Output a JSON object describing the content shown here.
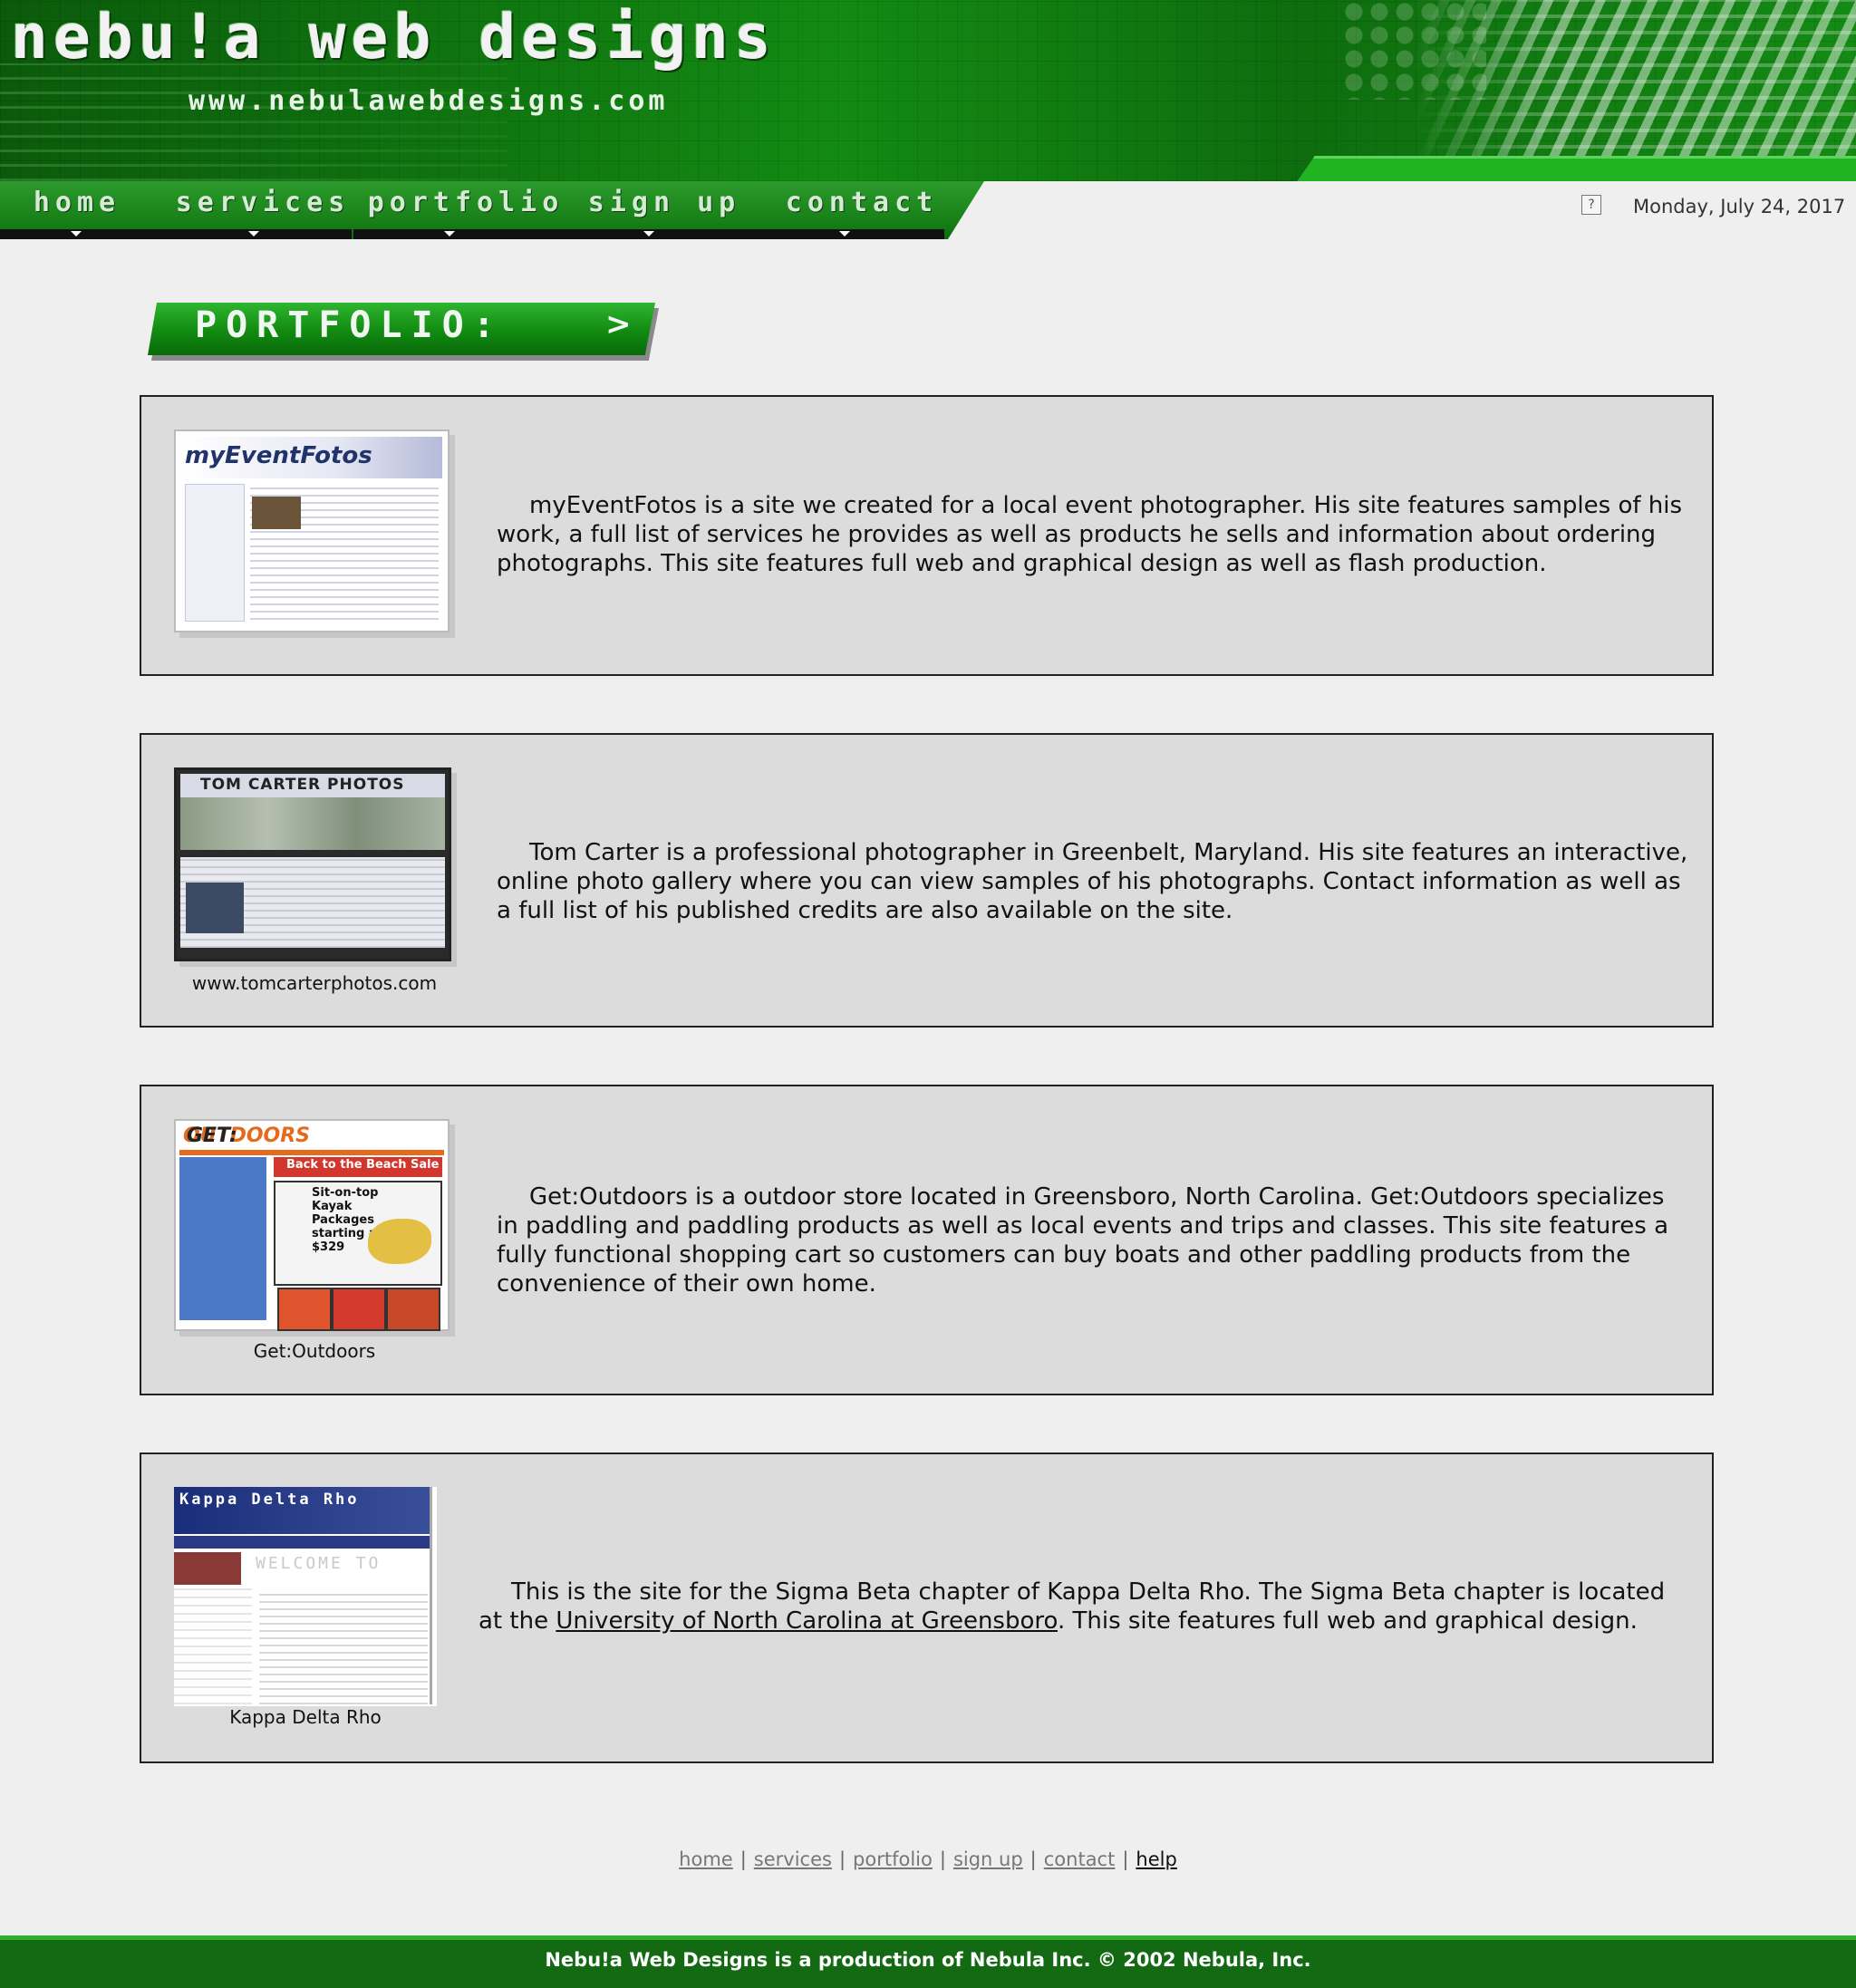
{
  "header": {
    "logo_text": "nebu!a web designs",
    "url_text": "www.nebulawebdesigns.com"
  },
  "nav": {
    "items": [
      {
        "label": "home"
      },
      {
        "label": "services"
      },
      {
        "label": "portfolio"
      },
      {
        "label": "sign up"
      },
      {
        "label": "contact"
      }
    ]
  },
  "status": {
    "help_icon": "?",
    "date": "Monday, July 24, 2017"
  },
  "banner": {
    "title": "PORTFOLIO:",
    "chevron": ">"
  },
  "portfolio": [
    {
      "thumb_title": "myEventFotos",
      "caption": "",
      "description": "myEventFotos is a site we created for a local event photographer. His site features samples of his work, a full list of services he provides as well as products he sells and information about ordering photographs. This site features full web and graphical design as well as flash production."
    },
    {
      "thumb_title": "TOM CARTER PHOTOS",
      "caption": "www.tomcarterphotos.com",
      "description": "Tom Carter is a professional photographer in Greenbelt, Maryland. His site features an interactive, online photo gallery where you can view samples of his photographs. Contact information as well as a full list of his published credits are also available on the site."
    },
    {
      "thumb_title_a": "GET:",
      "thumb_title_b": "OUTDOORS",
      "thumb_sale": "Back to the Beach Sale",
      "thumb_offer": "Sit-on-top Kayak Packages starting at $329",
      "caption": "Get:Outdoors",
      "description": "Get:Outdoors is a outdoor store located in Greensboro, North Carolina. Get:Outdoors specializes in paddling and paddling products as well as local events and trips and classes. This site features a fully functional shopping cart so customers can buy boats and other paddling products from the convenience of their own home."
    },
    {
      "thumb_title": "Kappa Delta Rho",
      "thumb_welcome": "WELCOME TO",
      "caption": "Kappa Delta Rho",
      "description_before": "This is the site for the Sigma Beta chapter of Kappa Delta Rho. The Sigma Beta chapter is located at the ",
      "description_link": "University of North Carolina at Greensboro",
      "description_after": ". This site features full web and graphical design."
    }
  ],
  "footer": {
    "links": [
      "home",
      "services",
      "portfolio",
      "sign up",
      "contact",
      "help"
    ],
    "separator": "|",
    "copyright": "Nebu!a Web Designs is a production of Nebula Inc. © 2002 Nebula, Inc."
  }
}
